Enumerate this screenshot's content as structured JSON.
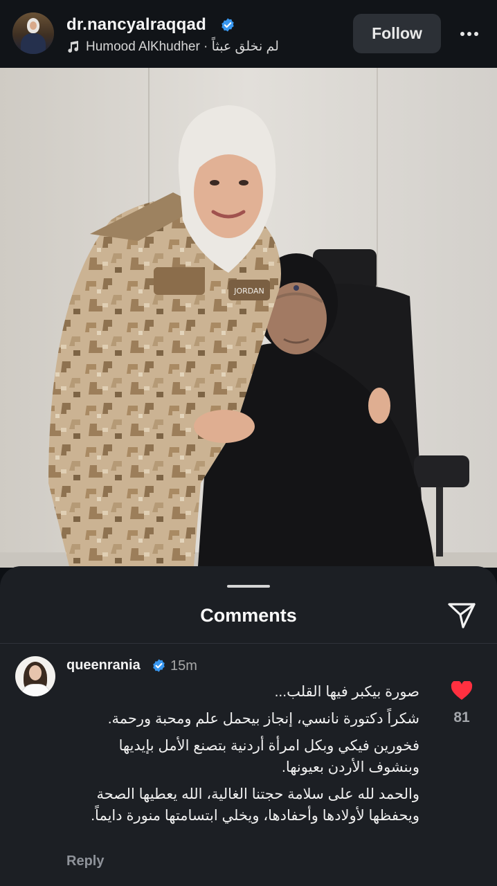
{
  "post": {
    "username": "dr.nancyalraqqad",
    "audio": "Humood AlKhudher · لم نخلق عبثاً",
    "follow_label": "Follow",
    "photo_patch_text": "JORDAN"
  },
  "comments_panel": {
    "title": "Comments",
    "comment": {
      "username": "queenrania",
      "time": "15m",
      "lines": [
        "صورة بيكبر فيها القلب...",
        "شكراً دكتورة نانسي، إنجاز بيحمل علم ومحبة ورحمة.",
        "فخورين فيكي وبكل امرأة أردنية بتصنع الأمل بإيديها وبنشوف الأردن بعيونها.",
        "والحمد لله على سلامة حجتنا الغالية، الله يعطيها الصحة ويحفظها لأولادها وأحفادها، ويخلي ابتسامتها منورة دايماً."
      ],
      "likes": "81",
      "reply_label": "Reply"
    }
  },
  "icons": {
    "verified": "verified-badge-icon",
    "music": "music-note-icon",
    "more": "more-horizontal-icon",
    "share": "send-icon",
    "heart": "heart-filled-icon"
  },
  "colors": {
    "background": "#0d1014",
    "sheet": "#1c1f24",
    "verified": "#3897f0",
    "like": "#ff3040",
    "follow_button": "#2c3036"
  }
}
